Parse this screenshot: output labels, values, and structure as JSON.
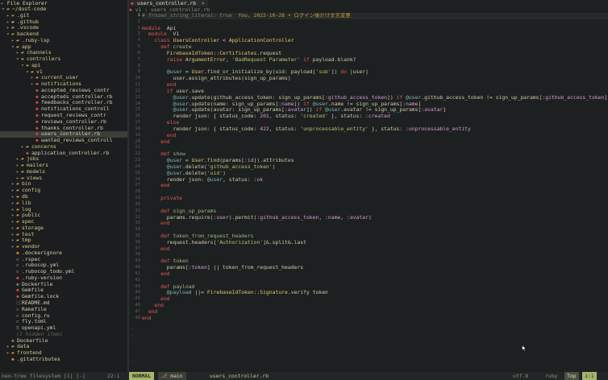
{
  "explorer": {
    "title": "File Explorer",
    "items": [
      {
        "depth": 0,
        "kind": "dir",
        "open": true,
        "icon": "folder-open-icon",
        "name": "~/dust-code"
      },
      {
        "depth": 1,
        "kind": "dir",
        "open": false,
        "icon": "git-folder-icon",
        "name": ".git"
      },
      {
        "depth": 1,
        "kind": "dir",
        "open": false,
        "icon": "github-folder-icon",
        "name": ".github"
      },
      {
        "depth": 1,
        "kind": "dir",
        "open": false,
        "icon": "folder-icon",
        "name": ".vscode"
      },
      {
        "depth": 1,
        "kind": "dir",
        "open": true,
        "icon": "folder-open-icon",
        "name": "backend"
      },
      {
        "depth": 2,
        "kind": "dir",
        "open": false,
        "icon": "folder-icon",
        "name": ".ruby-lsp"
      },
      {
        "depth": 2,
        "kind": "dir",
        "open": true,
        "icon": "folder-open-icon",
        "name": "app"
      },
      {
        "depth": 3,
        "kind": "dir",
        "open": false,
        "icon": "folder-icon",
        "name": "channels"
      },
      {
        "depth": 3,
        "kind": "dir",
        "open": true,
        "icon": "folder-open-icon",
        "name": "controllers"
      },
      {
        "depth": 4,
        "kind": "dir",
        "open": true,
        "icon": "folder-open-icon",
        "name": "api"
      },
      {
        "depth": 5,
        "kind": "dir",
        "open": true,
        "icon": "folder-open-icon",
        "name": "v1"
      },
      {
        "depth": 6,
        "kind": "dir",
        "open": false,
        "icon": "folder-icon",
        "name": "current_user"
      },
      {
        "depth": 6,
        "kind": "dir",
        "open": false,
        "icon": "folder-icon",
        "name": "notifications"
      },
      {
        "depth": 6,
        "kind": "file",
        "icon": "ruby-file-icon",
        "name": "accepted_reviews_contr"
      },
      {
        "depth": 6,
        "kind": "file",
        "icon": "ruby-file-icon",
        "name": "accepteds_controller.rb"
      },
      {
        "depth": 6,
        "kind": "file",
        "icon": "ruby-file-icon",
        "name": "feedbacks_controller.rb"
      },
      {
        "depth": 6,
        "kind": "file",
        "icon": "ruby-file-icon",
        "name": "notifications_controll"
      },
      {
        "depth": 6,
        "kind": "file",
        "icon": "ruby-file-icon",
        "name": "request_reviews_contr"
      },
      {
        "depth": 6,
        "kind": "file",
        "icon": "ruby-file-icon",
        "name": "reviews_controller.rb"
      },
      {
        "depth": 6,
        "kind": "file",
        "icon": "ruby-file-icon",
        "name": "thanks_controller.rb"
      },
      {
        "depth": 6,
        "kind": "file",
        "icon": "ruby-file-icon",
        "name": "users_controller.rb",
        "selected": true
      },
      {
        "depth": 6,
        "kind": "file",
        "icon": "ruby-file-icon",
        "name": "wanted_reviews_controll"
      },
      {
        "depth": 4,
        "kind": "dir",
        "open": false,
        "icon": "folder-icon",
        "name": "concerns"
      },
      {
        "depth": 4,
        "kind": "file",
        "icon": "ruby-file-icon",
        "name": "application_controller.rb"
      },
      {
        "depth": 3,
        "kind": "dir",
        "open": false,
        "icon": "folder-icon",
        "name": "jobs"
      },
      {
        "depth": 3,
        "kind": "dir",
        "open": false,
        "icon": "folder-icon",
        "name": "mailers"
      },
      {
        "depth": 3,
        "kind": "dir",
        "open": false,
        "icon": "folder-icon",
        "name": "models"
      },
      {
        "depth": 3,
        "kind": "dir",
        "open": false,
        "icon": "folder-icon",
        "name": "views"
      },
      {
        "depth": 2,
        "kind": "dir",
        "open": false,
        "icon": "folder-icon",
        "name": "bin"
      },
      {
        "depth": 2,
        "kind": "dir",
        "open": false,
        "icon": "folder-icon",
        "name": "config"
      },
      {
        "depth": 2,
        "kind": "dir",
        "open": false,
        "icon": "folder-icon",
        "name": "db"
      },
      {
        "depth": 2,
        "kind": "dir",
        "open": false,
        "icon": "folder-icon",
        "name": "lib"
      },
      {
        "depth": 2,
        "kind": "dir",
        "open": false,
        "icon": "folder-icon",
        "name": "log"
      },
      {
        "depth": 2,
        "kind": "dir",
        "open": false,
        "icon": "folder-icon",
        "name": "public"
      },
      {
        "depth": 2,
        "kind": "dir",
        "open": false,
        "icon": "folder-icon",
        "name": "spec"
      },
      {
        "depth": 2,
        "kind": "dir",
        "open": false,
        "icon": "folder-icon",
        "name": "storage"
      },
      {
        "depth": 2,
        "kind": "dir",
        "open": false,
        "icon": "folder-icon",
        "name": "test"
      },
      {
        "depth": 2,
        "kind": "dir",
        "open": false,
        "icon": "folder-icon",
        "name": "tmp"
      },
      {
        "depth": 2,
        "kind": "dir",
        "open": false,
        "icon": "folder-icon",
        "name": "vendor"
      },
      {
        "depth": 2,
        "kind": "file",
        "icon": "git-file-icon",
        "name": ".dockerignore"
      },
      {
        "depth": 2,
        "kind": "file",
        "icon": "file-icon",
        "name": ".rspec"
      },
      {
        "depth": 2,
        "kind": "file",
        "icon": "file-icon",
        "name": ".rubocop.yml"
      },
      {
        "depth": 2,
        "kind": "file",
        "icon": "file-icon",
        "name": ".rubocop_todo.yml"
      },
      {
        "depth": 2,
        "kind": "file",
        "icon": "ruby-file-icon",
        "name": ".ruby-version"
      },
      {
        "depth": 2,
        "kind": "file",
        "icon": "docker-file-icon",
        "name": "Dockerfile"
      },
      {
        "depth": 2,
        "kind": "file",
        "icon": "ruby-file-icon",
        "name": "Gemfile"
      },
      {
        "depth": 2,
        "kind": "file",
        "icon": "ruby-file-icon",
        "name": "Gemfile.lock"
      },
      {
        "depth": 2,
        "kind": "file",
        "icon": "readme-file-icon",
        "name": "README.md"
      },
      {
        "depth": 2,
        "kind": "file",
        "icon": "file-icon",
        "name": "Rakefile"
      },
      {
        "depth": 2,
        "kind": "file",
        "icon": "file-icon",
        "name": "config.ru"
      },
      {
        "depth": 2,
        "kind": "file",
        "icon": "file-icon",
        "name": "fly.toml"
      },
      {
        "depth": 2,
        "kind": "file",
        "icon": "yaml-file-icon",
        "name": "openapi.yml"
      },
      {
        "depth": 2,
        "kind": "hint",
        "icon": "",
        "name": "(1 hidden item)"
      },
      {
        "depth": 1,
        "kind": "file",
        "icon": "docker-file-icon",
        "name": "Dockerfile"
      },
      {
        "depth": 1,
        "kind": "dir",
        "open": false,
        "icon": "folder-icon",
        "name": "data"
      },
      {
        "depth": 1,
        "kind": "dir",
        "open": false,
        "icon": "folder-icon",
        "name": "frontend"
      },
      {
        "depth": 1,
        "kind": "file",
        "icon": "git-file-icon",
        "name": ".gitattributes"
      }
    ]
  },
  "tab": {
    "label": "users_controller.rb",
    "close": "×"
  },
  "winbar": {
    "path": "v1 › users_controller.rb"
  },
  "editor": {
    "cursor_line": 1,
    "lines": [
      [
        [
          "c-comment",
          "# frozen_string_literal: true"
        ],
        [
          "c-hint",
          "  You, 2022-10-28 • ログイン後だけ文言変更"
        ]
      ],
      [],
      [
        [
          "c-kw",
          "module"
        ],
        [
          "",
          "  Api"
        ]
      ],
      [
        [
          "",
          "  "
        ],
        [
          "c-kw",
          "module"
        ],
        [
          "",
          "  V1"
        ]
      ],
      [
        [
          "",
          "    "
        ],
        [
          "c-kw",
          "class"
        ],
        [
          "c-const",
          " UsersController"
        ],
        [
          "",
          " < "
        ],
        [
          "c-const",
          "ApplicationController"
        ]
      ],
      [
        [
          "",
          "      "
        ],
        [
          "c-kw",
          "def"
        ],
        [
          "c-meth",
          " create"
        ]
      ],
      [
        [
          "",
          "        "
        ],
        [
          "c-const",
          "FirebaseIdToken"
        ],
        [
          "",
          "::"
        ],
        [
          "c-const",
          "Certificates"
        ],
        [
          "",
          ".request"
        ]
      ],
      [
        [
          "",
          "        "
        ],
        [
          "c-kw",
          "raise"
        ],
        [
          "c-const",
          " ArgumentError"
        ],
        [
          "",
          ", "
        ],
        [
          "c-str",
          "'BadRequest Parameter'"
        ],
        [
          "c-kw",
          " if"
        ],
        [
          "",
          " payload.blank?"
        ]
      ],
      [],
      [
        [
          "",
          "        "
        ],
        [
          "c-ivar",
          "@user"
        ],
        [
          "",
          " = "
        ],
        [
          "c-const",
          "User"
        ],
        [
          "",
          ".find_or_initialize_by(uid: payload["
        ],
        [
          "c-str",
          "'sub'"
        ],
        [
          "",
          "]) "
        ],
        [
          "c-kw",
          "do"
        ],
        [
          "",
          " |user|"
        ]
      ],
      [
        [
          "",
          "          user.assign_attributes(sign_up_params)"
        ]
      ],
      [
        [
          "",
          "        "
        ],
        [
          "c-kw",
          "end"
        ]
      ],
      [
        [
          "",
          "        "
        ],
        [
          "c-kw",
          "if"
        ],
        [
          "",
          " user.save"
        ]
      ],
      [
        [
          "",
          "          "
        ],
        [
          "c-ivar",
          "@user"
        ],
        [
          "",
          ".update(github_access_token: sign_up_params["
        ],
        [
          "c-sym",
          ":github_access_token"
        ],
        [
          "",
          "]) "
        ],
        [
          "c-kw",
          "if"
        ],
        [
          "c-ivar",
          " @user"
        ],
        [
          "",
          ".github_access_token != sign_up_params["
        ],
        [
          "c-sym",
          ":github_access_token"
        ],
        [
          "",
          "]"
        ]
      ],
      [
        [
          "",
          "          "
        ],
        [
          "c-ivar",
          "@user"
        ],
        [
          "",
          ".update(name: sign_up_params["
        ],
        [
          "c-sym",
          ":name"
        ],
        [
          "",
          "]) "
        ],
        [
          "c-kw",
          "if"
        ],
        [
          "c-ivar",
          " @user"
        ],
        [
          "",
          ".name != sign_up_params["
        ],
        [
          "c-sym",
          ":name"
        ],
        [
          "",
          "]"
        ]
      ],
      [
        [
          "",
          "          "
        ],
        [
          "c-ivar",
          "@user"
        ],
        [
          "",
          ".update(avatar: sign_up_params["
        ],
        [
          "c-sym",
          ":avatar"
        ],
        [
          "",
          "]) "
        ],
        [
          "c-kw",
          "if"
        ],
        [
          "c-ivar",
          " @user"
        ],
        [
          "",
          ".avatar != sign_up_params["
        ],
        [
          "c-sym",
          ":avatar"
        ],
        [
          "",
          "]"
        ]
      ],
      [
        [
          "",
          "          render json: { status_code: "
        ],
        [
          "c-num",
          "201"
        ],
        [
          "",
          ", status: "
        ],
        [
          "c-str",
          "'created'"
        ],
        [
          "",
          " }, status: "
        ],
        [
          "c-sym",
          ":created"
        ]
      ],
      [
        [
          "",
          "        "
        ],
        [
          "c-kw",
          "else"
        ]
      ],
      [
        [
          "",
          "          render json: { status_code: "
        ],
        [
          "c-num",
          "422"
        ],
        [
          "",
          ", status: "
        ],
        [
          "c-str",
          "'unprocessable_entity'"
        ],
        [
          "",
          " }, status: "
        ],
        [
          "c-sym",
          ":unprocessable_entity"
        ]
      ],
      [
        [
          "",
          "        "
        ],
        [
          "c-kw",
          "end"
        ]
      ],
      [
        [
          "",
          "      "
        ],
        [
          "c-kw",
          "end"
        ]
      ],
      [],
      [
        [
          "",
          "      "
        ],
        [
          "c-kw",
          "def"
        ],
        [
          "c-meth",
          " show"
        ]
      ],
      [
        [
          "",
          "        "
        ],
        [
          "c-ivar",
          "@user"
        ],
        [
          "",
          " = "
        ],
        [
          "c-const",
          "User"
        ],
        [
          "",
          ".find(params["
        ],
        [
          "c-sym",
          ":id"
        ],
        [
          "",
          "]).attributes"
        ]
      ],
      [
        [
          "",
          "        "
        ],
        [
          "c-ivar",
          "@user"
        ],
        [
          "",
          ".delete("
        ],
        [
          "c-str",
          "'github_access_token'"
        ],
        [
          "",
          ")"
        ]
      ],
      [
        [
          "",
          "        "
        ],
        [
          "c-ivar",
          "@user"
        ],
        [
          "",
          ".delete("
        ],
        [
          "c-str",
          "'uid'"
        ],
        [
          "",
          ")"
        ]
      ],
      [
        [
          "",
          "        render json: "
        ],
        [
          "c-ivar",
          "@user"
        ],
        [
          "",
          ", status: "
        ],
        [
          "c-sym",
          ":ok"
        ]
      ],
      [
        [
          "",
          "      "
        ],
        [
          "c-kw",
          "end"
        ]
      ],
      [],
      [
        [
          "",
          "      "
        ],
        [
          "c-kw",
          "private"
        ]
      ],
      [],
      [
        [
          "",
          "      "
        ],
        [
          "c-kw",
          "def"
        ],
        [
          "c-meth",
          " sign_up_params"
        ]
      ],
      [
        [
          "",
          "        params.require("
        ],
        [
          "c-sym",
          ":user"
        ],
        [
          "",
          ").permit("
        ],
        [
          "c-sym",
          ":github_access_token"
        ],
        [
          "",
          ", "
        ],
        [
          "c-sym",
          ":name"
        ],
        [
          "",
          ", "
        ],
        [
          "c-sym",
          ":avatar"
        ],
        [
          "",
          ")"
        ]
      ],
      [
        [
          "",
          "      "
        ],
        [
          "c-kw",
          "end"
        ]
      ],
      [],
      [
        [
          "",
          "      "
        ],
        [
          "c-kw",
          "def"
        ],
        [
          "c-meth",
          " token_from_request_headers"
        ]
      ],
      [
        [
          "",
          "        request.headers["
        ],
        [
          "c-str",
          "'Authorization'"
        ],
        [
          "",
          "]&.split&.last"
        ]
      ],
      [
        [
          "",
          "      "
        ],
        [
          "c-kw",
          "end"
        ]
      ],
      [],
      [
        [
          "",
          "      "
        ],
        [
          "c-kw",
          "def"
        ],
        [
          "c-meth",
          " token"
        ]
      ],
      [
        [
          "",
          "        params["
        ],
        [
          "c-sym",
          ":token"
        ],
        [
          "",
          "] || token_from_request_headers"
        ]
      ],
      [
        [
          "",
          "      "
        ],
        [
          "c-kw",
          "end"
        ]
      ],
      [],
      [
        [
          "",
          "      "
        ],
        [
          "c-kw",
          "def"
        ],
        [
          "c-meth",
          " payload"
        ]
      ],
      [
        [
          "",
          "        "
        ],
        [
          "c-ivar",
          "@payload"
        ],
        [
          "",
          " ||= "
        ],
        [
          "c-const",
          "FirebaseIdToken"
        ],
        [
          "",
          "::"
        ],
        [
          "c-const",
          "Signature"
        ],
        [
          "",
          ".verify token"
        ]
      ],
      [
        [
          "",
          "      "
        ],
        [
          "c-kw",
          "end"
        ]
      ],
      [
        [
          "",
          "    "
        ],
        [
          "c-kw",
          "end"
        ]
      ],
      [
        [
          "",
          "  "
        ],
        [
          "c-kw",
          "end"
        ]
      ],
      [
        [
          "c-kw",
          "end"
        ]
      ]
    ],
    "line_numbers": [
      "1",
      "1",
      "2",
      "3",
      "4",
      "5",
      "6",
      "7",
      "8",
      "9",
      "10",
      "11",
      "12",
      "13",
      "14",
      "15",
      "16",
      "17",
      "18",
      "19",
      "20",
      "21",
      "22",
      "23",
      "24",
      "25",
      "26",
      "27",
      "28",
      "29",
      "30",
      "31",
      "32",
      "33",
      "34",
      "35",
      "36",
      "37",
      "38",
      "39",
      "40",
      "41",
      "42",
      "43",
      "44",
      "45",
      "46",
      "47",
      "48"
    ],
    "filler_lines": 7,
    "filler_char": "~"
  },
  "statusbar": {
    "left_label": "neo-tree filesystem [1] [-]",
    "left_pos": "22:1",
    "mode": "NORMAL",
    "branch": "main",
    "file": "users_controller.rb",
    "encoding": "utf-8",
    "filetype": "ruby",
    "scroll": "Top",
    "position": "1:1"
  },
  "colors": {
    "accent": "#a7b56d",
    "background": "#1d2021",
    "ruby_icon": "#d84a3a",
    "folder_icon": "#d69a38"
  }
}
